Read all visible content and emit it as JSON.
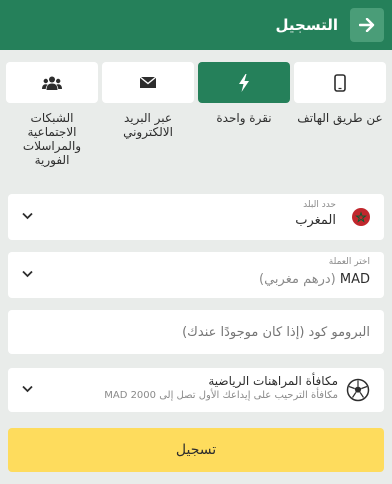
{
  "header": {
    "title": "التسجيل",
    "back_icon": "arrow-right-icon"
  },
  "tabs": [
    {
      "key": "phone",
      "label": "عن طريق الهاتف",
      "icon": "mobile-phone-icon"
    },
    {
      "key": "one_click",
      "label": "نقرة واحدة",
      "icon": "lightning-bolt-icon",
      "active": true
    },
    {
      "key": "email",
      "label": "عبر البريد الالكتروني",
      "icon": "envelope-icon"
    },
    {
      "key": "social",
      "label": "الشبكات الاجتماعية والمراسلات الفورية",
      "icon": "users-group-icon"
    }
  ],
  "country": {
    "label": "حدد البلد",
    "value": "المغرب",
    "flag": "morocco-flag-icon"
  },
  "currency": {
    "label": "اختر العملة",
    "value": "MAD",
    "value_note": "(درهم مغربي)"
  },
  "promo": {
    "placeholder": "البرومو كود (إذا كان موجودًا عندك)"
  },
  "bonus": {
    "title": "مكافأة المراهنات الرياضية",
    "description": "مكافأة الترحيب على إيداعك الأول تصل إلى MAD 2000",
    "icon": "soccer-ball-icon"
  },
  "submit": {
    "label": "تسجيل"
  },
  "colors": {
    "primary": "#25805a",
    "primary_light": "#4a9d78",
    "accent": "#fedc5d",
    "background": "#e9ecea"
  }
}
